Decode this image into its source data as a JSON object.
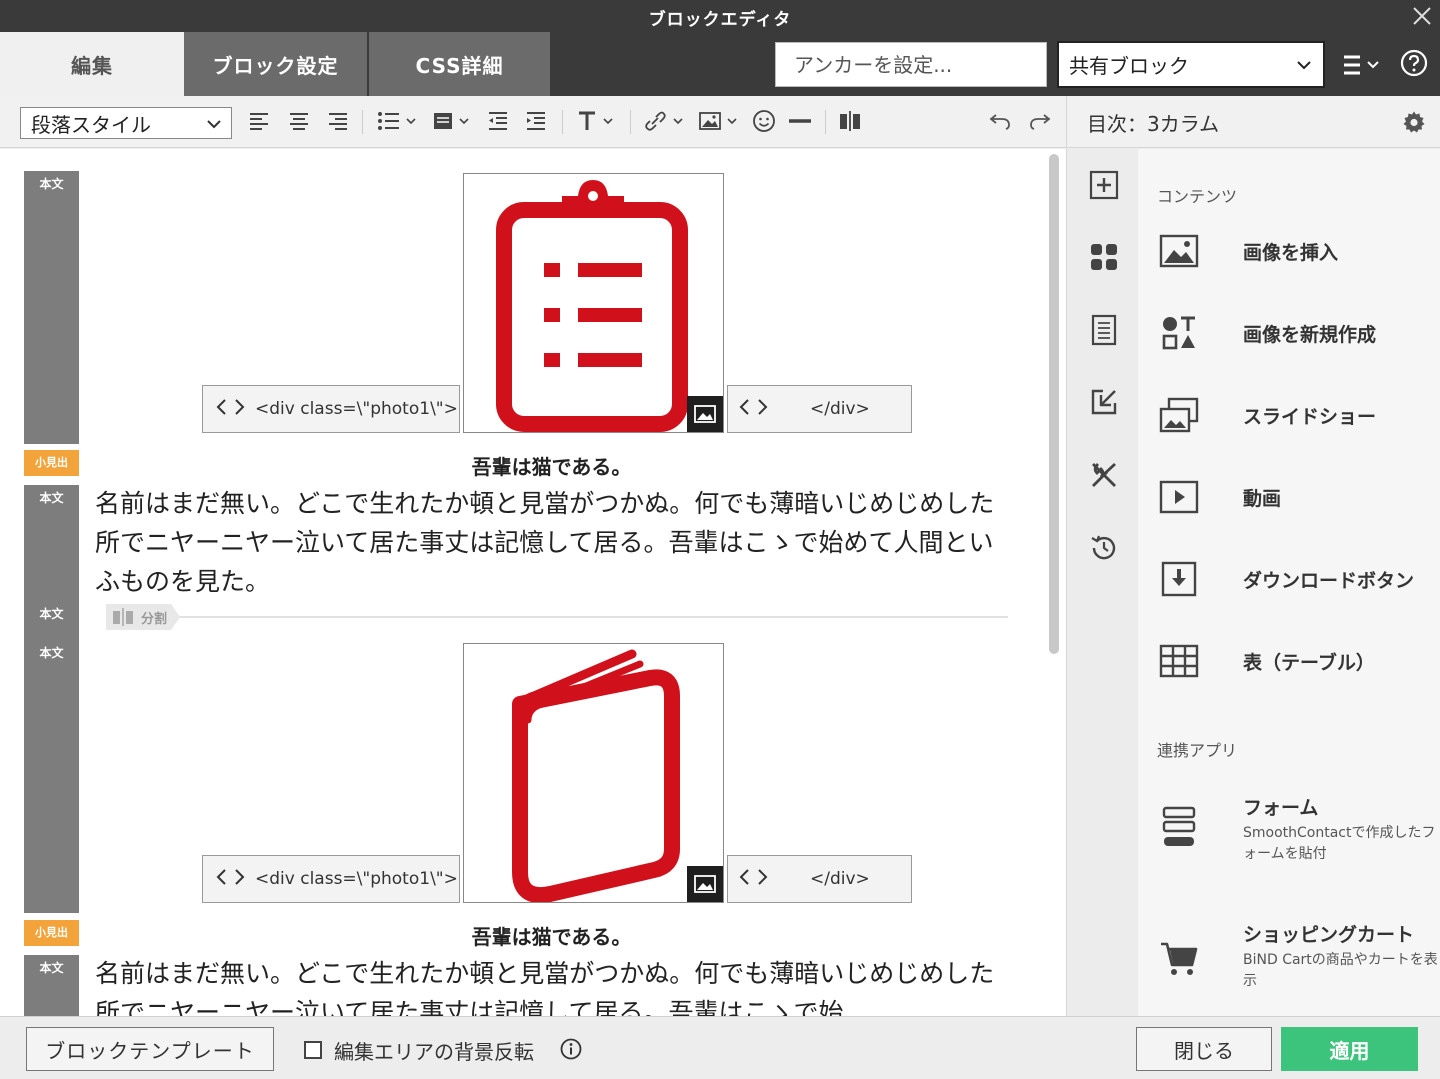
{
  "window": {
    "title": "ブロックエディタ"
  },
  "tabs": [
    {
      "label": "編集"
    },
    {
      "label": "ブロック設定"
    },
    {
      "label": "CSS詳細"
    }
  ],
  "anchor": {
    "placeholder": "アンカーを設定..."
  },
  "shared_block": {
    "value": "共有ブロック"
  },
  "toolbar": {
    "paragraph_style": "段落スタイル"
  },
  "sidebar_header": {
    "title": "目次：3カラム"
  },
  "editor": {
    "labels": {
      "body": "本文",
      "subheading": "小見出",
      "split": "分割"
    },
    "blocks": [
      {
        "code_open": "<div class=\\\"photo1\\\">",
        "code_close": "</div>",
        "caption": "吾輩は猫である。",
        "text": "名前はまだ無い。どこで生れたか頓と見當がつかぬ。何でも薄暗いじめじめした所でニヤーニヤー泣いて居た事丈は記憶して居る。吾輩はこゝで始めて人間といふものを見た。"
      },
      {
        "code_open": "<div class=\\\"photo1\\\">",
        "code_close": "</div>",
        "caption": "吾輩は猫である。",
        "text": "名前はまだ無い。どこで生れたか頓と見當がつかぬ。何でも薄暗いじめじめした所でニヤーニヤー泣いて居た事丈は記憶して居る。吾輩はこゝで始"
      }
    ]
  },
  "sidebar": {
    "contents_title": "コンテンツ",
    "contents": [
      {
        "label": "画像を挿入",
        "icon": "image-icon"
      },
      {
        "label": "画像を新規作成",
        "icon": "shapes-icon"
      },
      {
        "label": "スライドショー",
        "icon": "slideshow-icon"
      },
      {
        "label": "動画",
        "icon": "video-icon"
      },
      {
        "label": "ダウンロードボタン",
        "icon": "download-icon"
      },
      {
        "label": "表（テーブル）",
        "icon": "table-icon"
      }
    ],
    "apps_title": "連携アプリ",
    "apps": [
      {
        "label": "フォーム",
        "desc": "SmoothContactで作成したフォームを貼付",
        "icon": "form-icon"
      },
      {
        "label": "ショッピングカート",
        "desc": "BiND Cartの商品やカートを表示",
        "icon": "cart-icon"
      }
    ]
  },
  "footer": {
    "template_button": "ブロックテンプレート",
    "invert_bg_label": "編集エリアの背景反転",
    "close_button": "閉じる",
    "apply_button": "適用"
  },
  "colors": {
    "accent_red": "#d0111b",
    "apply_green": "#3cc47c",
    "label_orange": "#f2a33a"
  }
}
